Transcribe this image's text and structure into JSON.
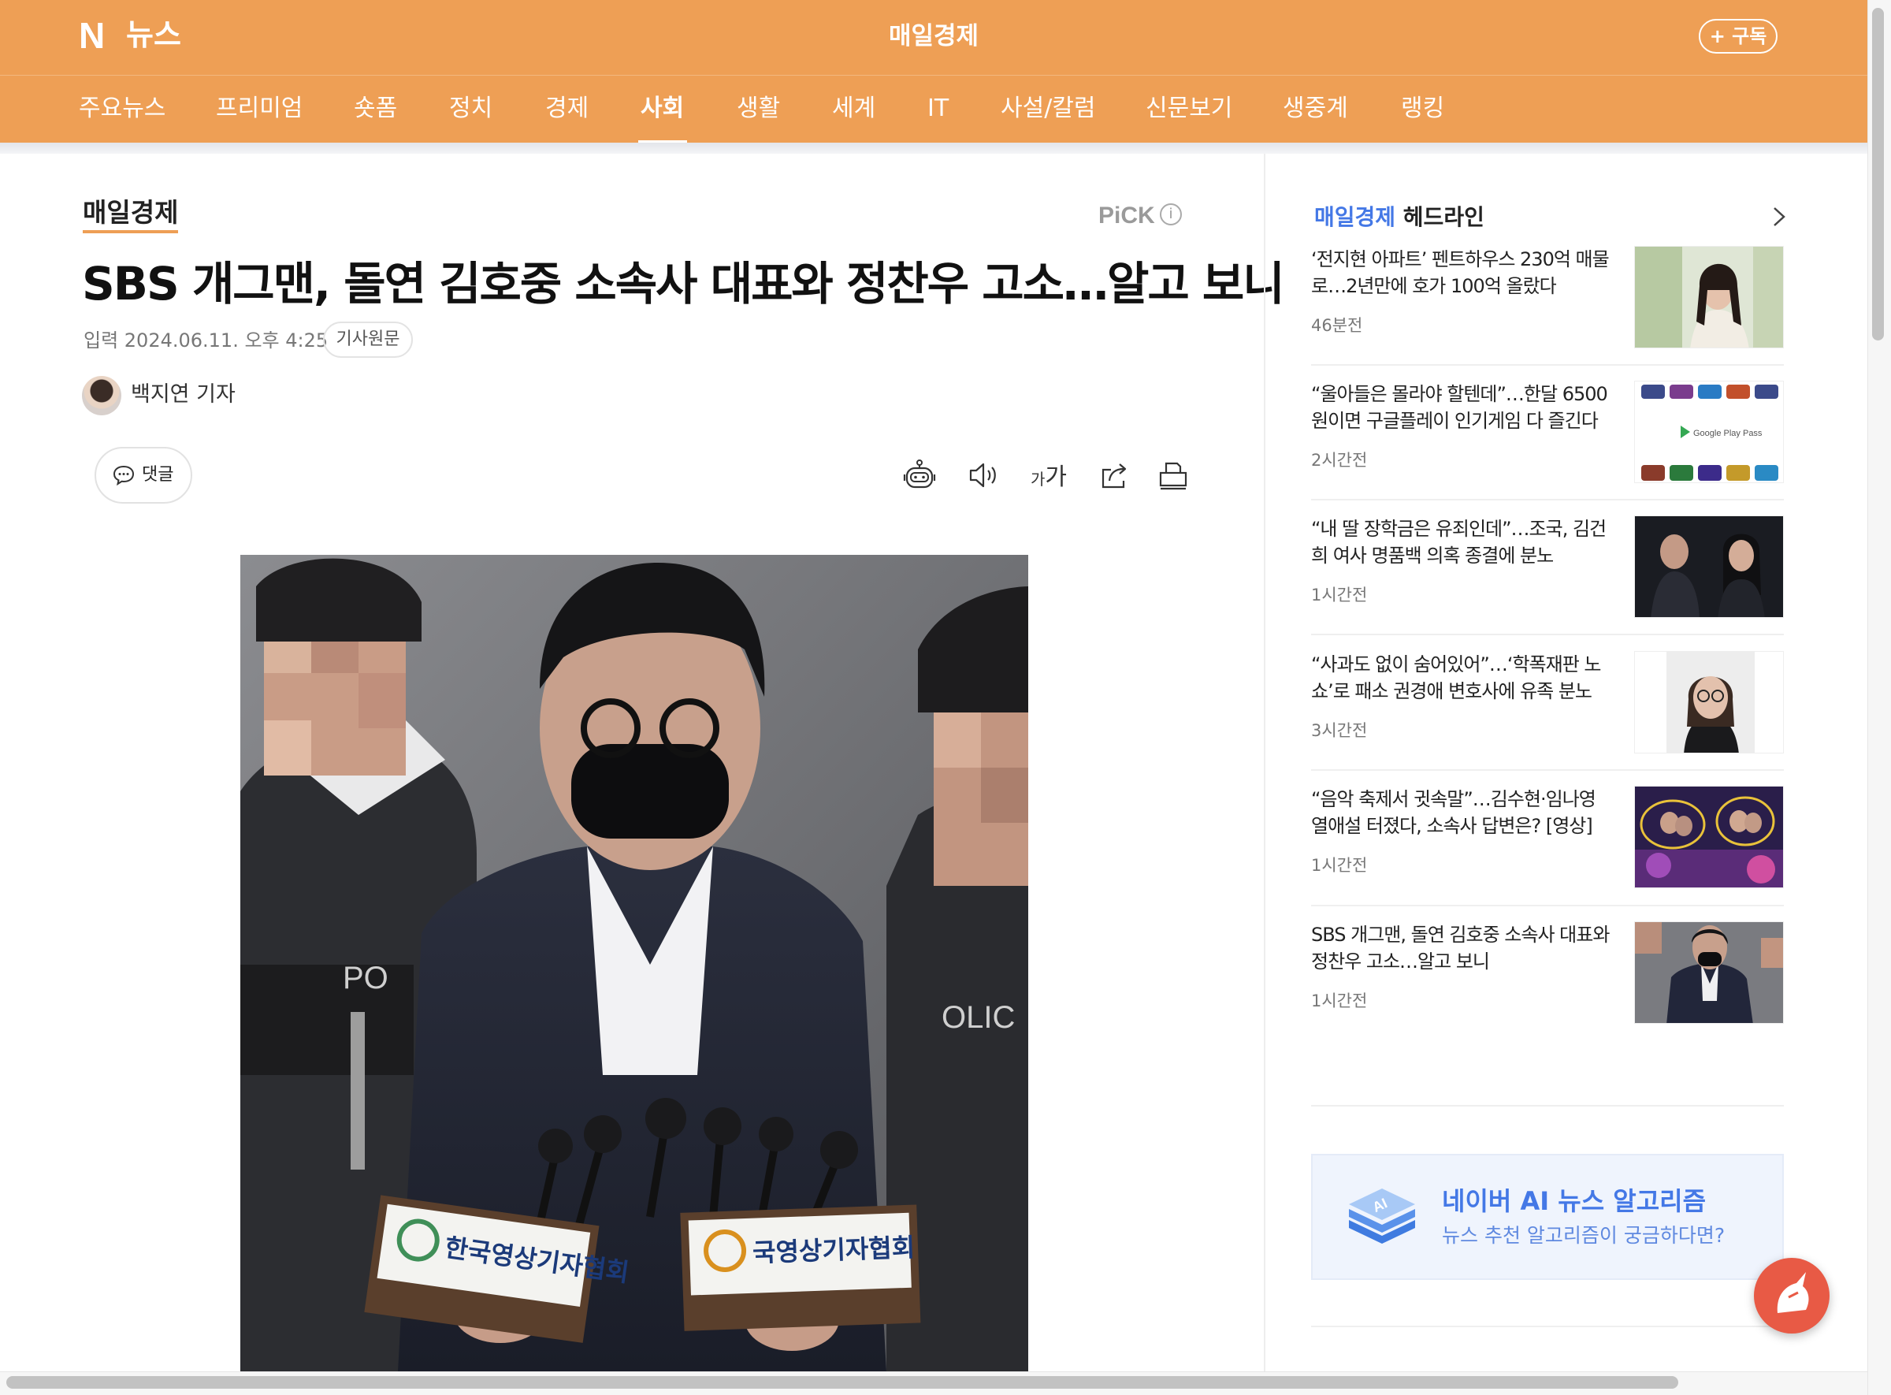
{
  "header": {
    "logo_letter": "N",
    "logo_text": "뉴스",
    "press_title": "매일경제",
    "subscribe_label": "+ 구독"
  },
  "nav": {
    "items": [
      "주요뉴스",
      "프리미엄",
      "숏폼",
      "정치",
      "경제",
      "사회",
      "생활",
      "세계",
      "IT",
      "사설/칼럼",
      "신문보기",
      "생중계",
      "랭킹"
    ],
    "active": "사회"
  },
  "article": {
    "press_name": "매일경제",
    "pick_label": "PiCK",
    "pick_info": "i",
    "headline": "SBS 개그맨, 돌연 김호중 소속사 대표와 정찬우 고소…알고 보니",
    "dateline": "입력 2024.06.11. 오후 4:25",
    "original_button": "기사원문",
    "reporter": "백지연 기자",
    "comment_label": "댓글",
    "font_tool_small": "가",
    "font_tool_big": "가"
  },
  "sidebar": {
    "title_press": "매일경제",
    "title_rest": " 헤드라인",
    "items": [
      {
        "title": "‘전지현 아파트’ 펜트하우스 230억 매물로…2년만에 호가 100억 올랐다",
        "time": "46분전"
      },
      {
        "title": "“울아들은 몰라야 할텐데”…한달 6500원이면 구글플레이 인기게임 다 즐긴다",
        "time": "2시간전"
      },
      {
        "title": "“내 딸 장학금은 유죄인데”…조국, 김건희 여사 명품백 의혹 종결에 분노",
        "time": "1시간전"
      },
      {
        "title": "“사과도 없이 숨어있어”…‘학폭재판 노쇼’로 패소 권경애 변호사에 유족 분노",
        "time": "3시간전"
      },
      {
        "title": "“음악 축제서 귓속말”…김수현·임나영 열애설 터졌다, 소속사 답변은? [영상]",
        "time": "1시간전"
      },
      {
        "title": "SBS 개그맨, 돌연 김호중 소속사 대표와 정찬우 고소…알고 보니",
        "time": "1시간전"
      }
    ],
    "thumb_text_google": "Google Play Pass",
    "ai_box": {
      "title": "네이버 AI 뉴스 알고리즘",
      "subtitle": "뉴스 추천 알고리즘이 궁금하다면?",
      "badge": "AI"
    }
  },
  "photo": {
    "podium_left": "한국영상기자협회",
    "podium_right": "국영상기자협회"
  },
  "colors": {
    "brand_orange": "#EE9F55",
    "naver_blue": "#4478E6",
    "fab_red": "#E85A45"
  }
}
